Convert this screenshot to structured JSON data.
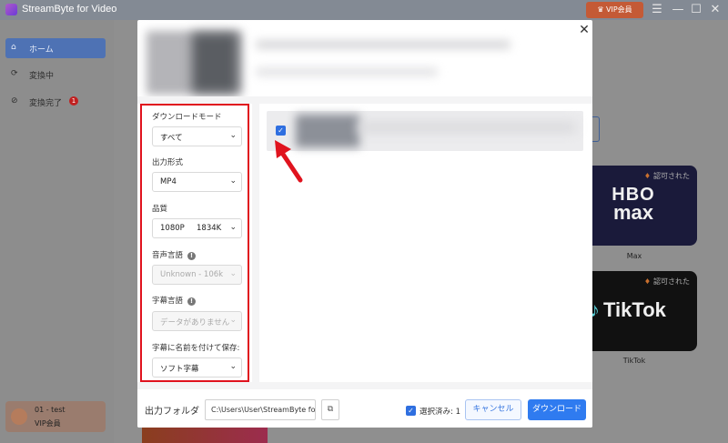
{
  "app": {
    "title": "StreamByte for Video",
    "vip_button": "♛ VIP会員"
  },
  "sidebar": {
    "items": [
      {
        "label": "ホーム",
        "icon": "home-icon"
      },
      {
        "label": "変換中",
        "icon": "converting-icon"
      },
      {
        "label": "変換完了",
        "icon": "check-circle-icon",
        "badge": "1"
      }
    ],
    "user": {
      "name": "01 - test",
      "status": "VIP会員"
    }
  },
  "services": [
    {
      "badge": "認可された",
      "caption": "Max",
      "logo_line1": "HBO",
      "logo_line2": "max"
    },
    {
      "badge": "認可された",
      "caption": "TikTok",
      "logo": "TikTok"
    }
  ],
  "dialog": {
    "settings": {
      "download_mode": {
        "label": "ダウンロードモード",
        "value": "すべて"
      },
      "output_format": {
        "label": "出力形式",
        "value": "MP4"
      },
      "quality": {
        "label": "品質",
        "value": "1080P",
        "size": "1834K"
      },
      "audio_language": {
        "label": "音声言語",
        "value": "Unknown - 106k"
      },
      "subtitle_language": {
        "label": "字幕言語",
        "value": "データがありません"
      },
      "save_subtitle": {
        "label": "字幕に名前を付けて保存:",
        "value": "ソフト字幕"
      }
    },
    "footer": {
      "output_folder_label": "出力フォルダ",
      "output_path": "C:\\Users\\User\\StreamByte fo",
      "selected_label": "選択済み: 1",
      "cancel": "キャンセル",
      "download": "ダウンロード"
    }
  },
  "colors": {
    "accent": "#2f7bf0",
    "highlight": "#e0131e",
    "vip": "#c45a36"
  }
}
